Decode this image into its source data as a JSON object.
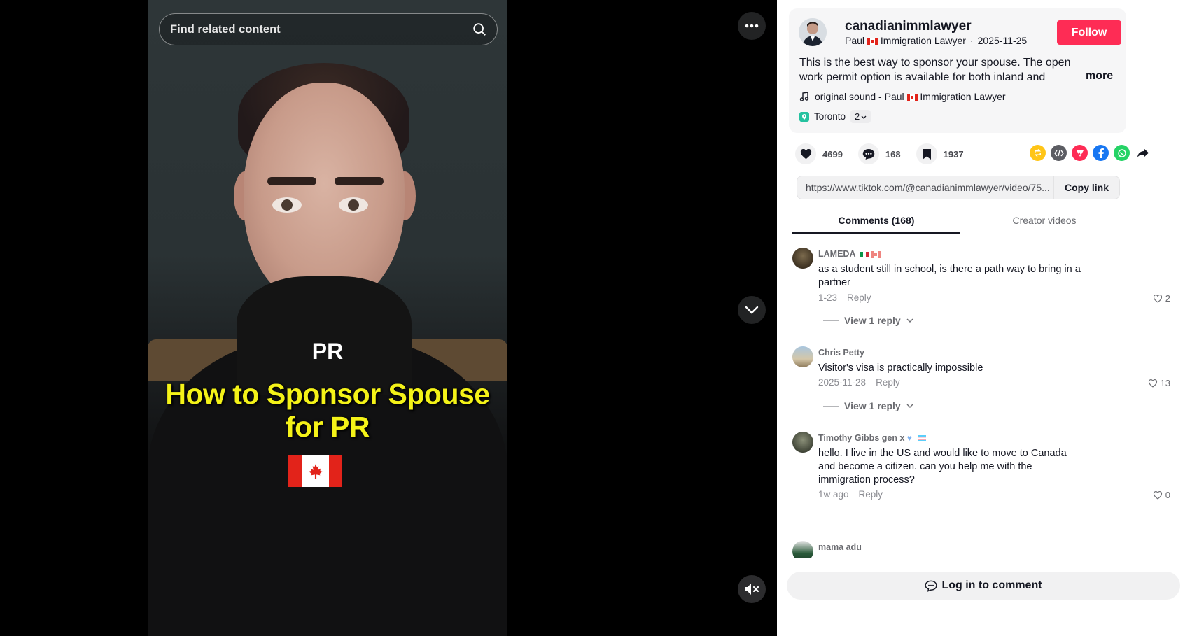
{
  "video": {
    "search_placeholder": "Find related content",
    "caption_tag": "PR",
    "caption_title": "How to Sponsor Spouse for PR"
  },
  "author": {
    "username": "canadianimmlawyer",
    "display_name_prefix": "Paul",
    "display_name_suffix": "Immigration Lawyer",
    "date": "2025-11-25",
    "follow_label": "Follow"
  },
  "post": {
    "description": "This is the best way to sponsor your spouse. The open work permit option is available for both inland and outland...",
    "more_label": "more",
    "sound_prefix": "original sound - Paul",
    "sound_suffix": "Immigration Lawyer",
    "location": "Toronto",
    "location_extra": "2"
  },
  "stats": {
    "likes": "4699",
    "comments": "168",
    "saves": "1937"
  },
  "link": {
    "url": "https://www.tiktok.com/@canadianimmlawyer/video/75...",
    "copy_label": "Copy link"
  },
  "tabs": {
    "comments": "Comments (168)",
    "creator": "Creator videos"
  },
  "comments": [
    {
      "user": "LAMEDA",
      "text": "as a student still in school, is there a path way to bring in a partner",
      "date": "1-23",
      "reply": "Reply",
      "likes": "2",
      "view_replies": "View 1 reply"
    },
    {
      "user": "Chris Petty",
      "text": "Visitor's visa is practically impossible",
      "date": "2025-11-28",
      "reply": "Reply",
      "likes": "13",
      "view_replies": "View 1 reply"
    },
    {
      "user": "Timothy Gibbs gen x",
      "text": "hello. I live in the US and would like to move to Canada and become a citizen. can you help me with the immigration process?",
      "date": "1w ago",
      "reply": "Reply",
      "likes": "0"
    },
    {
      "user": "mama adu"
    }
  ],
  "login_label": "Log in to comment",
  "colors": {
    "brand": "#fe2c55",
    "caption_yellow": "#f4f218"
  }
}
